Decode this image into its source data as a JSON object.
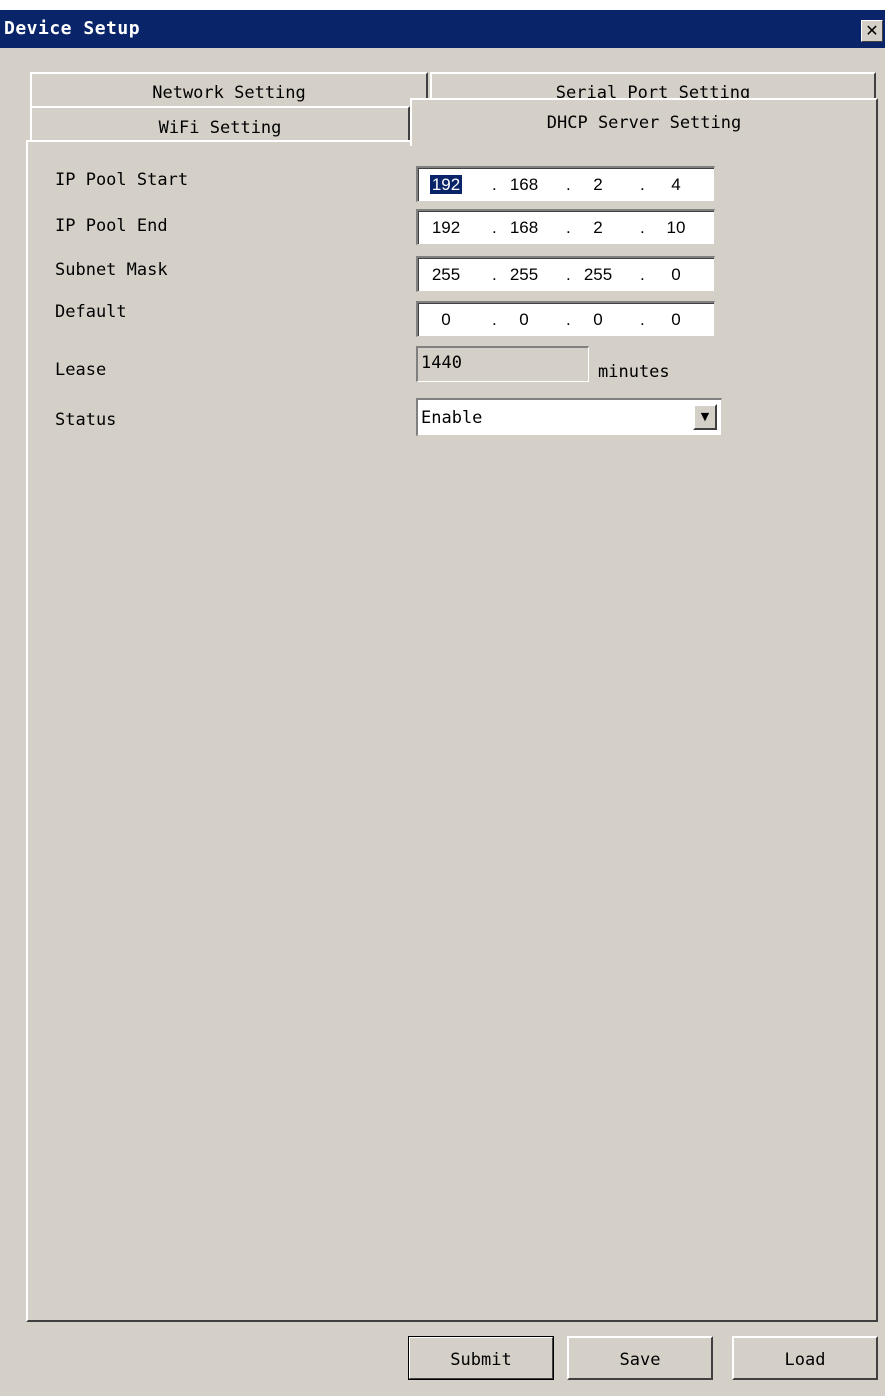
{
  "window": {
    "title": "Device Setup",
    "close_icon": "close-icon"
  },
  "tabs": {
    "network": "Network Setting",
    "serial": "Serial Port Setting",
    "wifi": "WiFi Setting",
    "dhcp": "DHCP Server Setting",
    "active": "DHCP Server Setting"
  },
  "form": {
    "ip_pool_start": {
      "label": "IP Pool Start",
      "octets": [
        "192",
        "168",
        "2",
        "4"
      ]
    },
    "ip_pool_end": {
      "label": "IP Pool End",
      "octets": [
        "192",
        "168",
        "2",
        "10"
      ]
    },
    "subnet_mask": {
      "label": "Subnet Mask",
      "octets": [
        "255",
        "255",
        "255",
        "0"
      ]
    },
    "default": {
      "label": "Default",
      "octets": [
        "0",
        "0",
        "0",
        "0"
      ]
    },
    "lease": {
      "label": "Lease",
      "value": "1440",
      "unit": "minutes"
    },
    "status": {
      "label": "Status",
      "value": "Enable",
      "arrow_icon": "chevron-down-icon"
    }
  },
  "buttons": {
    "submit": "Submit",
    "save": "Save",
    "load": "Load"
  },
  "colors": {
    "titlebar": "#0a246a",
    "face": "#d4d0c8",
    "selection": "#0a246a"
  }
}
